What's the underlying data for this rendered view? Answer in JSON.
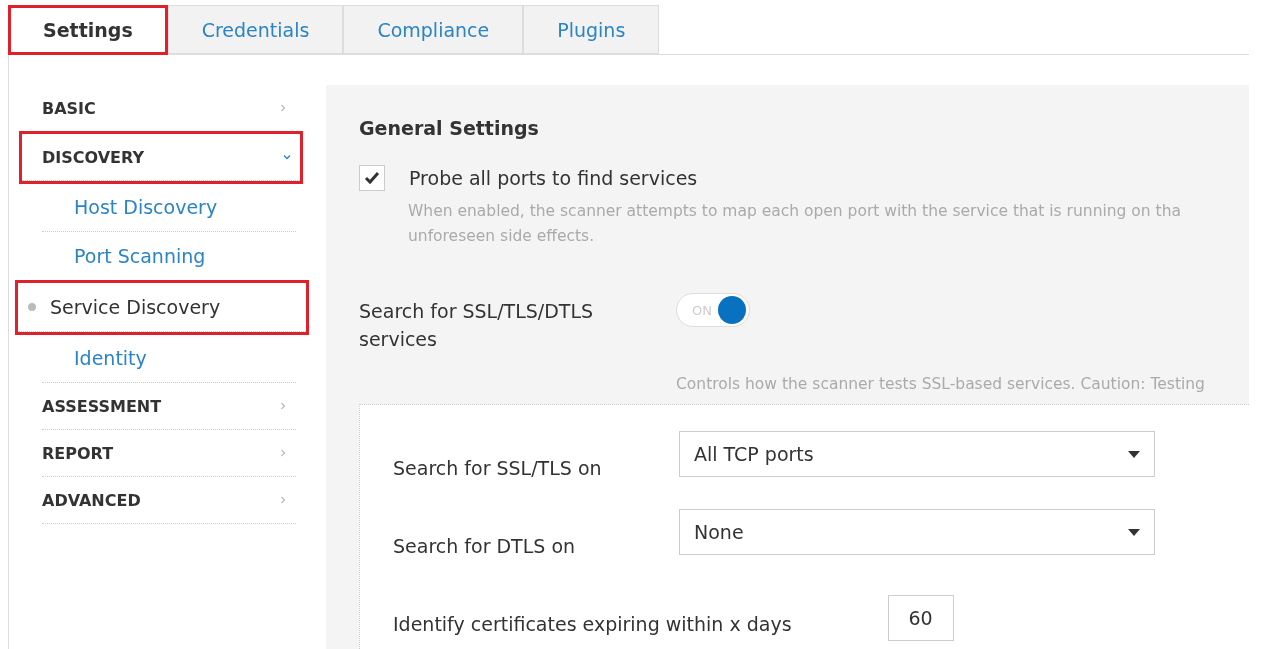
{
  "tabs": [
    {
      "label": "Settings",
      "selected": true,
      "highlighted": true
    },
    {
      "label": "Credentials",
      "selected": false,
      "highlighted": false
    },
    {
      "label": "Compliance",
      "selected": false,
      "highlighted": false
    },
    {
      "label": "Plugins",
      "selected": false,
      "highlighted": false
    }
  ],
  "sidebar": {
    "items": [
      {
        "label": "BASIC",
        "expanded": false,
        "highlighted": false
      },
      {
        "label": "DISCOVERY",
        "expanded": true,
        "highlighted": true,
        "children": [
          {
            "label": "Host Discovery",
            "selected": false,
            "highlighted": false
          },
          {
            "label": "Port Scanning",
            "selected": false,
            "highlighted": false
          },
          {
            "label": "Service Discovery",
            "selected": true,
            "highlighted": true
          },
          {
            "label": "Identity",
            "selected": false,
            "highlighted": false
          }
        ]
      },
      {
        "label": "ASSESSMENT",
        "expanded": false,
        "highlighted": false
      },
      {
        "label": "REPORT",
        "expanded": false,
        "highlighted": false
      },
      {
        "label": "ADVANCED",
        "expanded": false,
        "highlighted": false
      }
    ]
  },
  "content": {
    "heading": "General Settings",
    "checkbox": {
      "label": "Probe all ports to find services",
      "checked": true,
      "description": [
        "When enabled, the scanner attempts to map each open port with the service that is running on tha",
        "unforeseen side effects."
      ]
    },
    "toggle": {
      "label": "Search for SSL/TLS/DTLS services",
      "on": true,
      "state_text": "ON",
      "description": "Controls how the scanner tests SSL-based services. Caution: Testing"
    },
    "fields": [
      {
        "kind": "select",
        "label": "Search for SSL/TLS on",
        "value": "All TCP ports"
      },
      {
        "kind": "select",
        "label": "Search for DTLS on",
        "value": "None"
      },
      {
        "kind": "number",
        "label": "Identify certificates expiring within x days",
        "value": "60"
      }
    ]
  }
}
